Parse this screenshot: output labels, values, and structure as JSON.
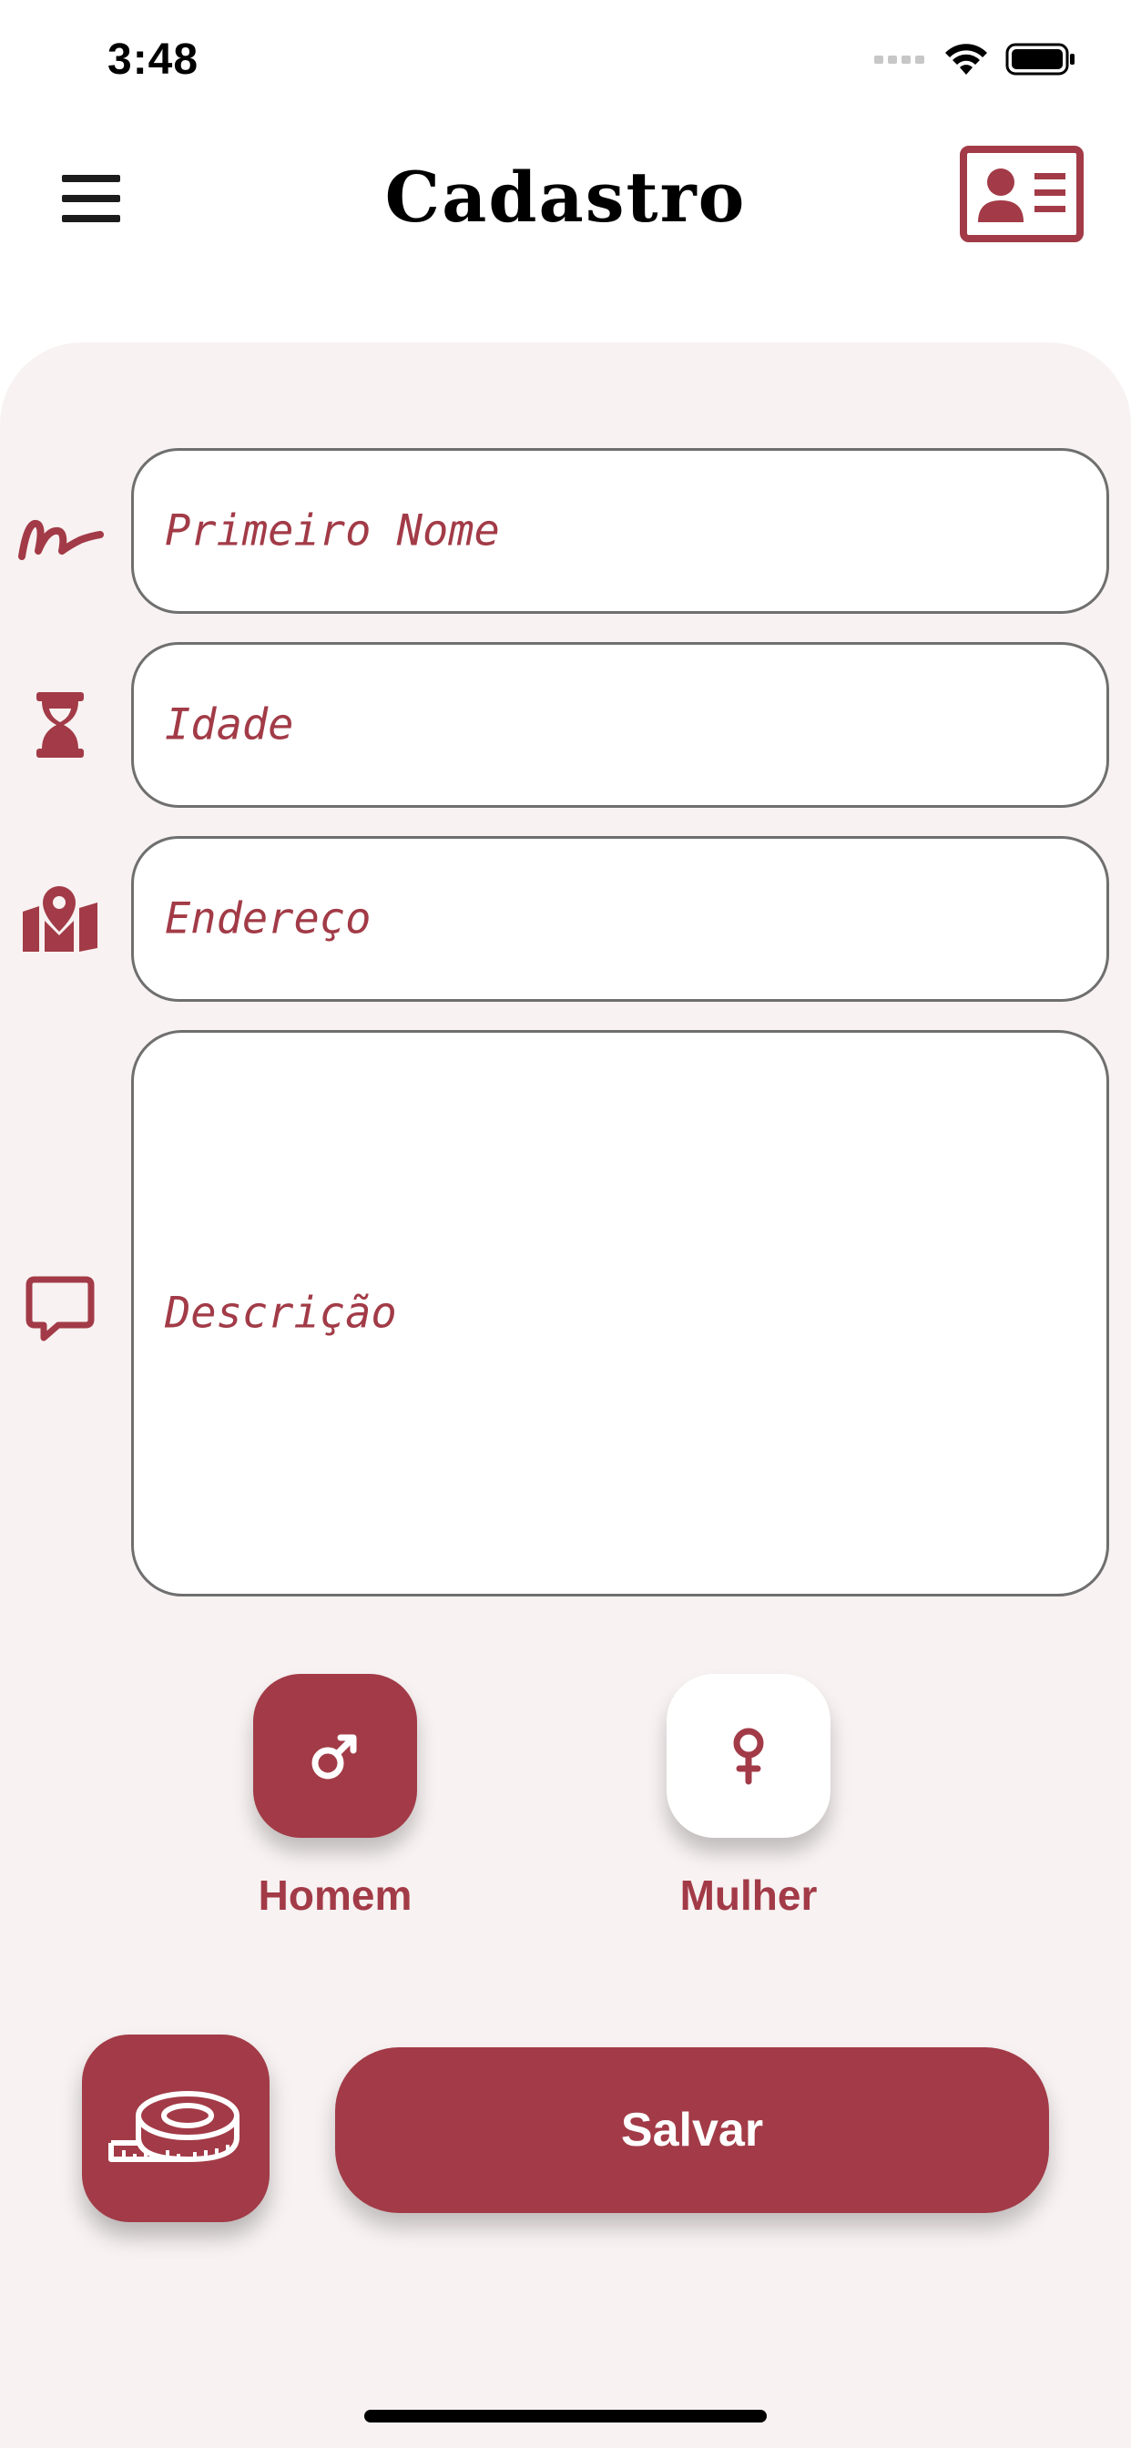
{
  "status_bar": {
    "time": "3:48",
    "icons": [
      "signal-icon",
      "wifi-icon",
      "battery-icon"
    ]
  },
  "header": {
    "title": "Cadastro",
    "left_icon": "menu-icon",
    "right_icon": "id-card-icon"
  },
  "form": {
    "fields": [
      {
        "icon": "signature-icon",
        "placeholder": "Primeiro Nome",
        "value": ""
      },
      {
        "icon": "hourglass-icon",
        "placeholder": "Idade",
        "value": ""
      },
      {
        "icon": "map-marker-icon",
        "placeholder": "Endereço",
        "value": ""
      },
      {
        "icon": "comment-icon",
        "placeholder": "Descrição",
        "value": ""
      }
    ]
  },
  "gender": {
    "options": [
      {
        "label": "Homem",
        "icon": "mars-icon",
        "selected": true
      },
      {
        "label": "Mulher",
        "icon": "venus-icon",
        "selected": false
      }
    ]
  },
  "actions": {
    "tape_icon": "tape-measure-icon",
    "save_label": "Salvar"
  },
  "colors": {
    "accent": "#a23b47",
    "card_background": "#f8f2f2",
    "field_border": "#6f6f6f"
  }
}
